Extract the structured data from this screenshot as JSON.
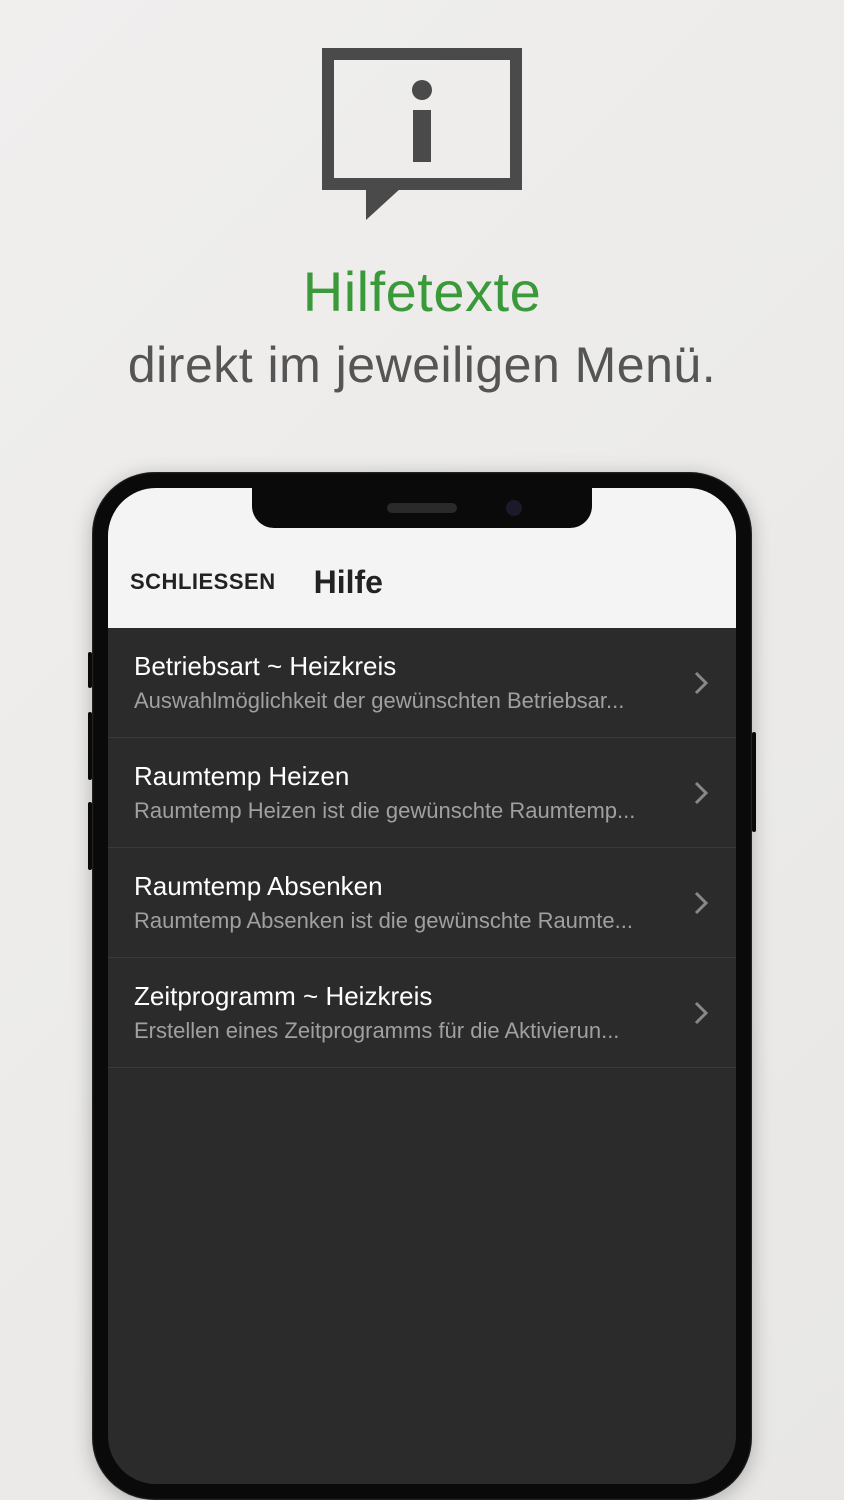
{
  "hero": {
    "title": "Hilfetexte",
    "subtitle": "direkt im jeweiligen Menü."
  },
  "app": {
    "close_label": "SCHLIESSEN",
    "header_title": "Hilfe",
    "items": [
      {
        "title": "Betriebsart ~ Heizkreis",
        "subtitle": "Auswahlmöglichkeit der gewünschten Betriebsar..."
      },
      {
        "title": "Raumtemp Heizen",
        "subtitle": "Raumtemp Heizen ist die gewünschte Raumtemp..."
      },
      {
        "title": "Raumtemp Absenken",
        "subtitle": "Raumtemp Absenken ist die gewünschte Raumte..."
      },
      {
        "title": "Zeitprogramm ~ Heizkreis",
        "subtitle": "Erstellen eines Zeitprogramms für die Aktivierun..."
      }
    ]
  }
}
